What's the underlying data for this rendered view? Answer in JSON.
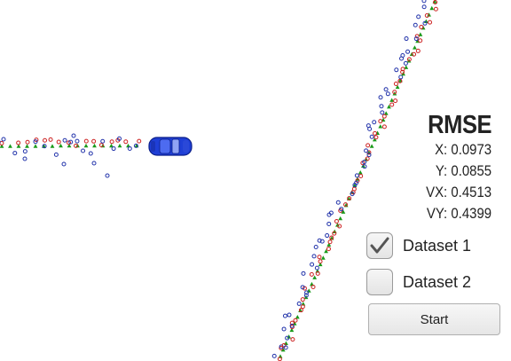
{
  "rmse": {
    "title": "RMSE",
    "x": "X: 0.0973",
    "y": "Y: 0.0855",
    "vx": "VX: 0.4513",
    "vy": "VY: 0.4399"
  },
  "controls": {
    "dataset1": {
      "label": "Dataset 1",
      "checked": true
    },
    "dataset2": {
      "label": "Dataset 2",
      "checked": false
    },
    "start_label": "Start"
  },
  "colors": {
    "ground_truth": "#1a9a1a",
    "lidar": "#cc2222",
    "radar": "#2233aa",
    "car_body": "#1f3fd6",
    "checkmark": "#555555"
  },
  "legend_icons": {
    "ground_truth": "green-triangle-icon",
    "lidar": "red-circle-icon",
    "radar": "blue-circle-icon",
    "car": "car-icon"
  }
}
